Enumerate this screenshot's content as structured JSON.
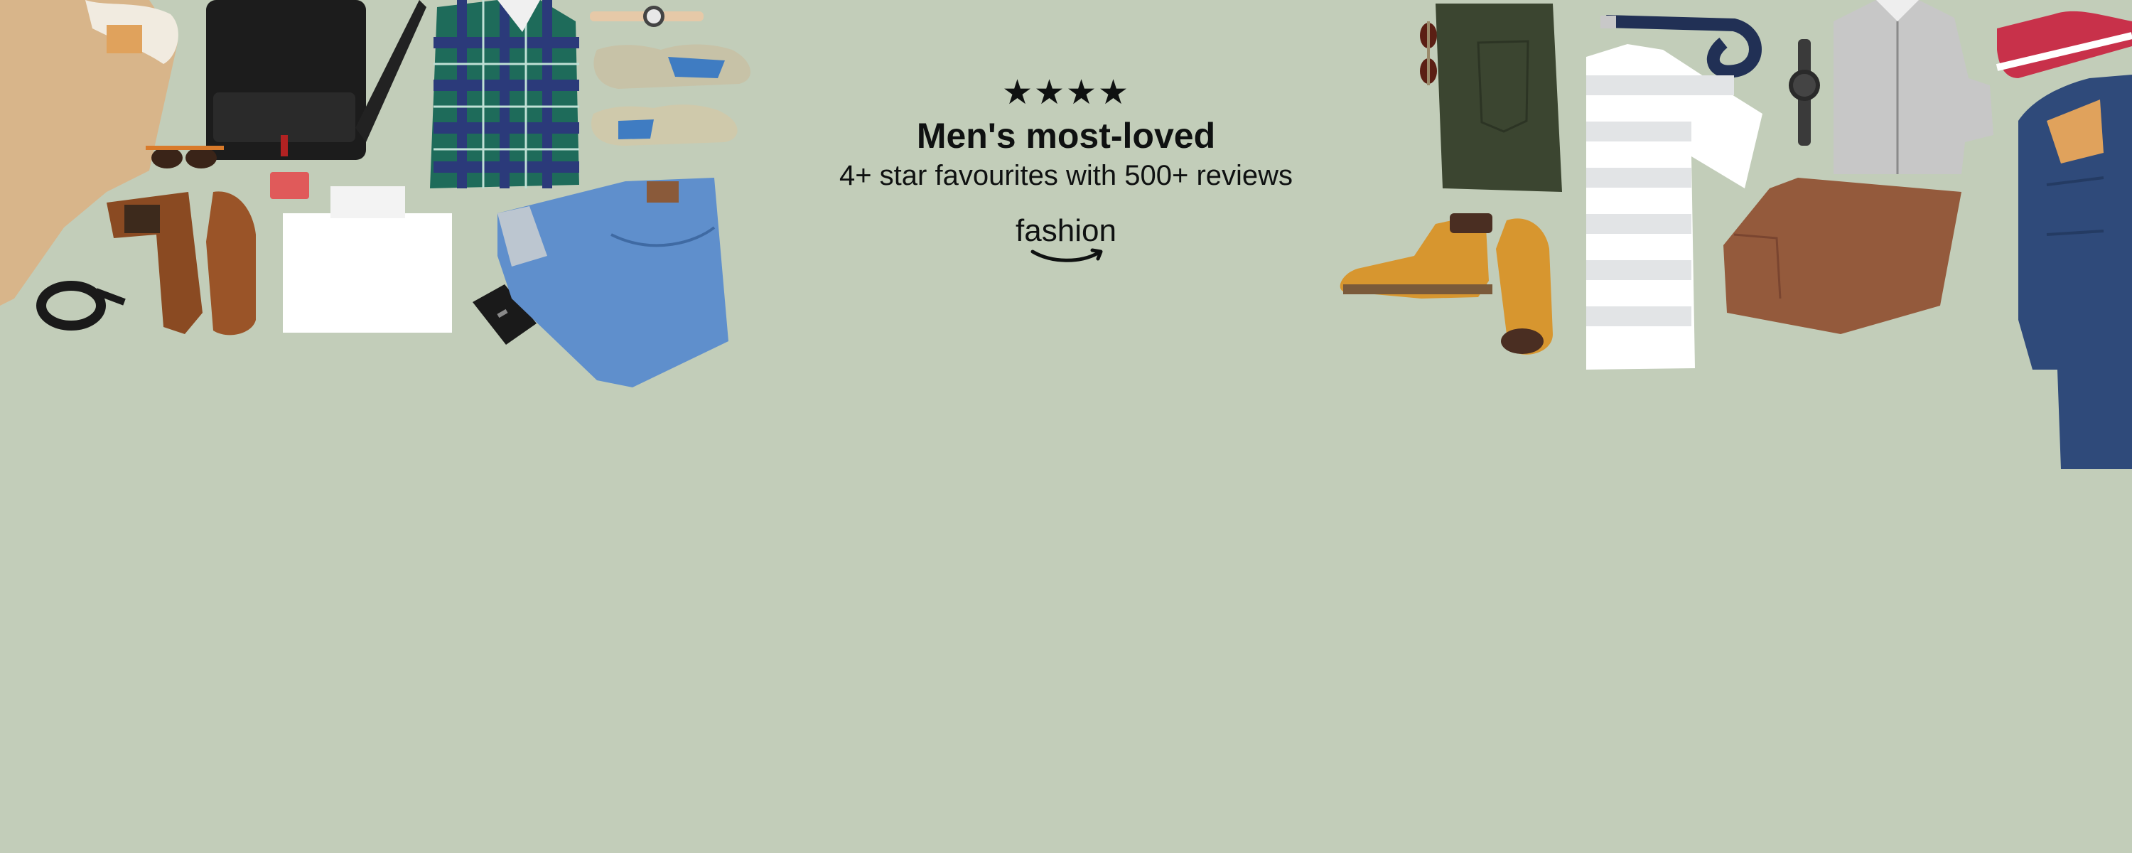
{
  "banner": {
    "stars": "★★★★",
    "headline": "Men's most-loved",
    "subheadline": "4+ star favourites with 500+ reviews",
    "logo_text": "fashion"
  },
  "colors": {
    "background": "#c2cdb9",
    "text": "#0f1111"
  },
  "products_left": [
    "jacket-image",
    "bag-image",
    "plaid-shirt-image",
    "watch-image",
    "sneaker-image",
    "sneaker-image",
    "sunglasses-image",
    "cardholder-image",
    "chelsea-boot-image",
    "brogue-image",
    "tshirt-image",
    "wallet-image",
    "jeans-image",
    "belt-image"
  ],
  "products_right": [
    "sunglasses-image",
    "chinos-image",
    "belt-image",
    "watch-image",
    "cardigan-image",
    "high-top-sneaker-image",
    "striped-tshirt-image",
    "work-boot-image",
    "work-boot-image",
    "trousers-image",
    "denim-jacket-image"
  ]
}
